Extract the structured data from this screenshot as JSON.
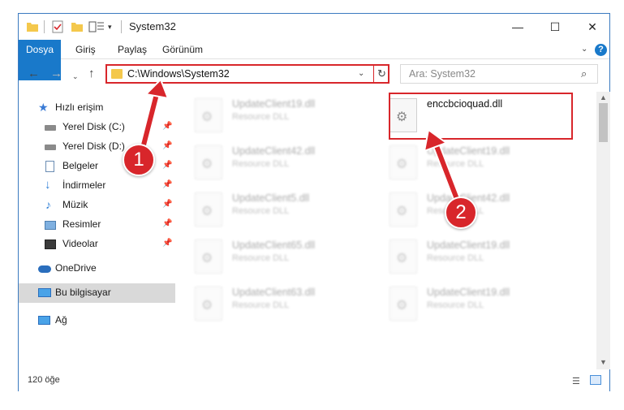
{
  "window": {
    "title": "System32",
    "min_label": "—",
    "max_label": "☐",
    "close_label": "✕"
  },
  "ribbon": {
    "tabs": [
      "Dosya",
      "Giriş",
      "Paylaş",
      "Görünüm"
    ],
    "help": "?"
  },
  "nav": {
    "back": "←",
    "forward": "→",
    "recent": "⌄",
    "up": "↑",
    "address": "C:\\Windows\\System32",
    "refresh": "↻",
    "search_placeholder": "Ara: System32"
  },
  "sidebar": {
    "items": [
      {
        "label": "Hızlı erişim",
        "icon": "star-icon"
      },
      {
        "label": "Yerel Disk (C:)",
        "icon": "drive-icon"
      },
      {
        "label": "Yerel Disk (D:)",
        "icon": "drive-icon"
      },
      {
        "label": "Belgeler",
        "icon": "document-icon"
      },
      {
        "label": "İndirmeler",
        "icon": "download-icon"
      },
      {
        "label": "Müzik",
        "icon": "music-icon"
      },
      {
        "label": "Resimler",
        "icon": "pictures-icon"
      },
      {
        "label": "Videolar",
        "icon": "video-icon"
      },
      {
        "label": "OneDrive",
        "icon": "cloud-icon"
      },
      {
        "label": "Bu bilgisayar",
        "icon": "computer-icon"
      },
      {
        "label": "Ağ",
        "icon": "network-icon"
      }
    ]
  },
  "files": [
    {
      "name": "UpdateClient19.dll",
      "type": "Resource DLL"
    },
    {
      "name": "enccbcioquad.dll",
      "type": ""
    },
    {
      "name": "UpdateClient42.dll",
      "type": "Resource DLL"
    },
    {
      "name": "UpdateClient19.dll",
      "type": "Resource DLL"
    },
    {
      "name": "UpdateClient5.dll",
      "type": "Resource DLL"
    },
    {
      "name": "UpdateClient42.dll",
      "type": "Resource DLL"
    },
    {
      "name": "UpdateClient65.dll",
      "type": "Resource DLL"
    },
    {
      "name": "UpdateClient19.dll",
      "type": "Resource DLL"
    },
    {
      "name": "UpdateClient63.dll",
      "type": "Resource DLL"
    },
    {
      "name": "UpdateClient19.dll",
      "type": "Resource DLL"
    }
  ],
  "status": {
    "count": "120 öğe"
  },
  "annotations": {
    "step1": "1",
    "step2": "2",
    "color": "#d8262b"
  },
  "colors": {
    "accent": "#1979ca",
    "highlight": "#d8262b"
  }
}
